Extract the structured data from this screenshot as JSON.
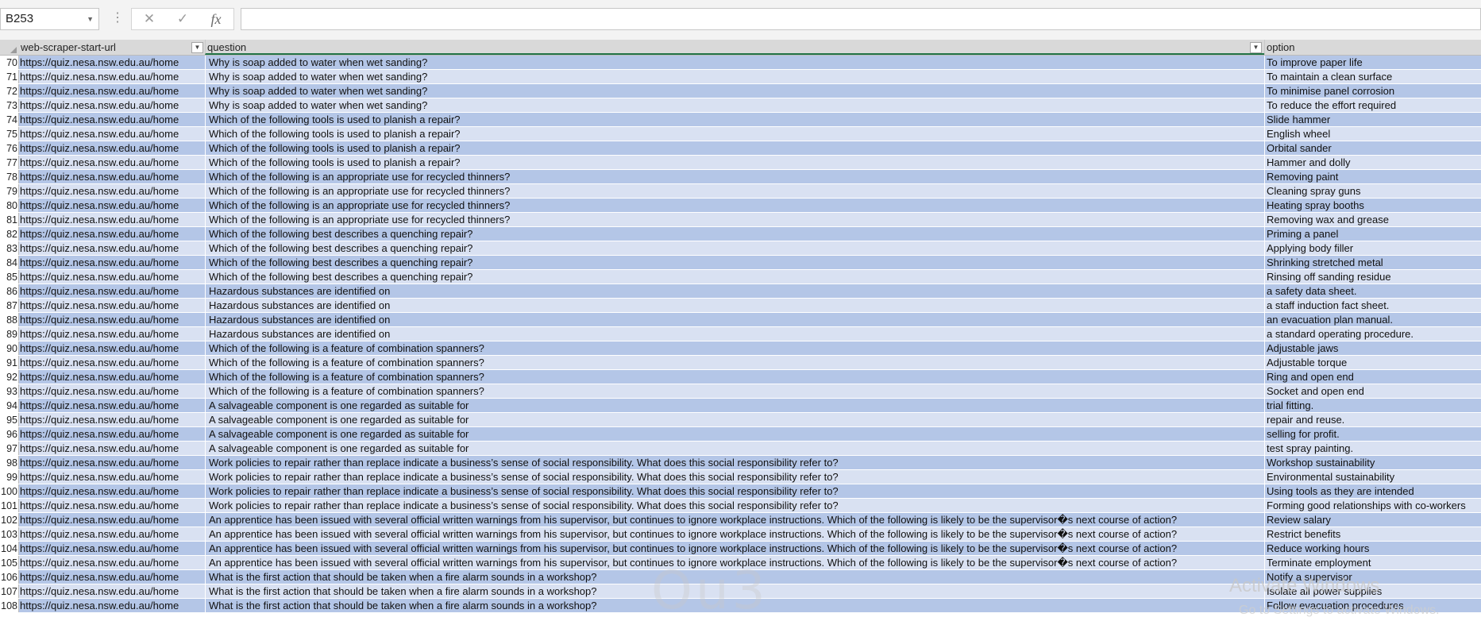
{
  "name_box": {
    "value": "B253"
  },
  "formula_bar": {
    "cancel_icon": "✕",
    "enter_icon": "✓",
    "fx_label": "fx",
    "value": ""
  },
  "columns": [
    {
      "label": "web-scraper-start-url",
      "filter": true
    },
    {
      "label": "question",
      "filter": true
    },
    {
      "label": "option",
      "filter": false
    }
  ],
  "rows": [
    {
      "n": "70",
      "url": "https://quiz.nesa.nsw.edu.au/home",
      "question": "Why is soap added to water when wet sanding?",
      "option": "To improve paper life"
    },
    {
      "n": "71",
      "url": "https://quiz.nesa.nsw.edu.au/home",
      "question": "Why is soap added to water when wet sanding?",
      "option": "To maintain a clean surface"
    },
    {
      "n": "72",
      "url": "https://quiz.nesa.nsw.edu.au/home",
      "question": "Why is soap added to water when wet sanding?",
      "option": "To minimise panel corrosion"
    },
    {
      "n": "73",
      "url": "https://quiz.nesa.nsw.edu.au/home",
      "question": "Why is soap added to water when wet sanding?",
      "option": "To reduce the effort required"
    },
    {
      "n": "74",
      "url": "https://quiz.nesa.nsw.edu.au/home",
      "question": "Which of the following tools is used to planish a repair?",
      "option": "Slide hammer"
    },
    {
      "n": "75",
      "url": "https://quiz.nesa.nsw.edu.au/home",
      "question": "Which of the following tools is used to planish a repair?",
      "option": "English wheel"
    },
    {
      "n": "76",
      "url": "https://quiz.nesa.nsw.edu.au/home",
      "question": "Which of the following tools is used to planish a repair?",
      "option": "Orbital sander"
    },
    {
      "n": "77",
      "url": "https://quiz.nesa.nsw.edu.au/home",
      "question": "Which of the following tools is used to planish a repair?",
      "option": "Hammer and dolly"
    },
    {
      "n": "78",
      "url": "https://quiz.nesa.nsw.edu.au/home",
      "question": "Which of the following is an appropriate use for recycled thinners?",
      "option": "Removing paint"
    },
    {
      "n": "79",
      "url": "https://quiz.nesa.nsw.edu.au/home",
      "question": "Which of the following is an appropriate use for recycled thinners?",
      "option": "Cleaning spray guns"
    },
    {
      "n": "80",
      "url": "https://quiz.nesa.nsw.edu.au/home",
      "question": "Which of the following is an appropriate use for recycled thinners?",
      "option": "Heating spray booths"
    },
    {
      "n": "81",
      "url": "https://quiz.nesa.nsw.edu.au/home",
      "question": "Which of the following is an appropriate use for recycled thinners?",
      "option": "Removing wax and grease"
    },
    {
      "n": "82",
      "url": "https://quiz.nesa.nsw.edu.au/home",
      "question": "Which of the following best describes a quenching repair?",
      "option": "Priming a panel"
    },
    {
      "n": "83",
      "url": "https://quiz.nesa.nsw.edu.au/home",
      "question": "Which of the following best describes a quenching repair?",
      "option": "Applying body filler"
    },
    {
      "n": "84",
      "url": "https://quiz.nesa.nsw.edu.au/home",
      "question": "Which of the following best describes a quenching repair?",
      "option": "Shrinking stretched metal"
    },
    {
      "n": "85",
      "url": "https://quiz.nesa.nsw.edu.au/home",
      "question": "Which of the following best describes a quenching repair?",
      "option": "Rinsing off sanding residue"
    },
    {
      "n": "86",
      "url": "https://quiz.nesa.nsw.edu.au/home",
      "question": "Hazardous substances are identified on",
      "option": "a safety data sheet."
    },
    {
      "n": "87",
      "url": "https://quiz.nesa.nsw.edu.au/home",
      "question": "Hazardous substances are identified on",
      "option": "a staff induction fact sheet."
    },
    {
      "n": "88",
      "url": "https://quiz.nesa.nsw.edu.au/home",
      "question": "Hazardous substances are identified on",
      "option": "an evacuation plan manual."
    },
    {
      "n": "89",
      "url": "https://quiz.nesa.nsw.edu.au/home",
      "question": "Hazardous substances are identified on",
      "option": "a standard operating procedure."
    },
    {
      "n": "90",
      "url": "https://quiz.nesa.nsw.edu.au/home",
      "question": "Which of the following is a feature of combination spanners?",
      "option": "Adjustable jaws"
    },
    {
      "n": "91",
      "url": "https://quiz.nesa.nsw.edu.au/home",
      "question": "Which of the following is a feature of combination spanners?",
      "option": "Adjustable torque"
    },
    {
      "n": "92",
      "url": "https://quiz.nesa.nsw.edu.au/home",
      "question": "Which of the following is a feature of combination spanners?",
      "option": "Ring and open end"
    },
    {
      "n": "93",
      "url": "https://quiz.nesa.nsw.edu.au/home",
      "question": "Which of the following is a feature of combination spanners?",
      "option": "Socket and open end"
    },
    {
      "n": "94",
      "url": "https://quiz.nesa.nsw.edu.au/home",
      "question": "A salvageable component is one regarded as suitable for",
      "option": "trial fitting."
    },
    {
      "n": "95",
      "url": "https://quiz.nesa.nsw.edu.au/home",
      "question": "A salvageable component is one regarded as suitable for",
      "option": "repair and reuse."
    },
    {
      "n": "96",
      "url": "https://quiz.nesa.nsw.edu.au/home",
      "question": "A salvageable component is one regarded as suitable for",
      "option": "selling for profit."
    },
    {
      "n": "97",
      "url": "https://quiz.nesa.nsw.edu.au/home",
      "question": "A salvageable component is one regarded as suitable for",
      "option": "test spray painting."
    },
    {
      "n": "98",
      "url": "https://quiz.nesa.nsw.edu.au/home",
      "question": "Work policies to repair rather than replace indicate a business’s sense of social responsibility. What does this social responsibility refer to?",
      "option": "Workshop sustainability"
    },
    {
      "n": "99",
      "url": "https://quiz.nesa.nsw.edu.au/home",
      "question": "Work policies to repair rather than replace indicate a business’s sense of social responsibility. What does this social responsibility refer to?",
      "option": "Environmental sustainability"
    },
    {
      "n": "100",
      "url": "https://quiz.nesa.nsw.edu.au/home",
      "question": "Work policies to repair rather than replace indicate a business’s sense of social responsibility. What does this social responsibility refer to?",
      "option": "Using tools as they are intended"
    },
    {
      "n": "101",
      "url": "https://quiz.nesa.nsw.edu.au/home",
      "question": "Work policies to repair rather than replace indicate a business’s sense of social responsibility. What does this social responsibility refer to?",
      "option": "Forming good relationships with co-workers"
    },
    {
      "n": "102",
      "url": "https://quiz.nesa.nsw.edu.au/home",
      "question": "An apprentice has been issued with several official written warnings from his supervisor, but continues to ignore workplace instructions. Which of the following is likely to be the supervisor�s next course of action?",
      "option": "Review salary"
    },
    {
      "n": "103",
      "url": "https://quiz.nesa.nsw.edu.au/home",
      "question": "An apprentice has been issued with several official written warnings from his supervisor, but continues to ignore workplace instructions. Which of the following is likely to be the supervisor�s next course of action?",
      "option": "Restrict benefits"
    },
    {
      "n": "104",
      "url": "https://quiz.nesa.nsw.edu.au/home",
      "question": "An apprentice has been issued with several official written warnings from his supervisor, but continues to ignore workplace instructions. Which of the following is likely to be the supervisor�s next course of action?",
      "option": "Reduce working hours"
    },
    {
      "n": "105",
      "url": "https://quiz.nesa.nsw.edu.au/home",
      "question": "An apprentice has been issued with several official written warnings from his supervisor, but continues to ignore workplace instructions. Which of the following is likely to be the supervisor�s next course of action?",
      "option": "Terminate employment"
    },
    {
      "n": "106",
      "url": "https://quiz.nesa.nsw.edu.au/home",
      "question": "What is the first action that should be taken when a fire alarm sounds in a workshop?",
      "option": "Notify a supervisor"
    },
    {
      "n": "107",
      "url": "https://quiz.nesa.nsw.edu.au/home",
      "question": "What is the first action that should be taken when a fire alarm sounds in a workshop?",
      "option": "Isolate all power supplies"
    },
    {
      "n": "108",
      "url": "https://quiz.nesa.nsw.edu.au/home",
      "question": "What is the first action that should be taken when a fire alarm sounds in a workshop?",
      "option": "Follow evacuation procedures"
    }
  ],
  "watermark": {
    "line1": "Activate Windows",
    "line2": "Go to Settings to activate Windows."
  },
  "colors": {
    "band_dark": "#b4c6e7",
    "band_light": "#d9e1f2",
    "accent": "#217346"
  }
}
